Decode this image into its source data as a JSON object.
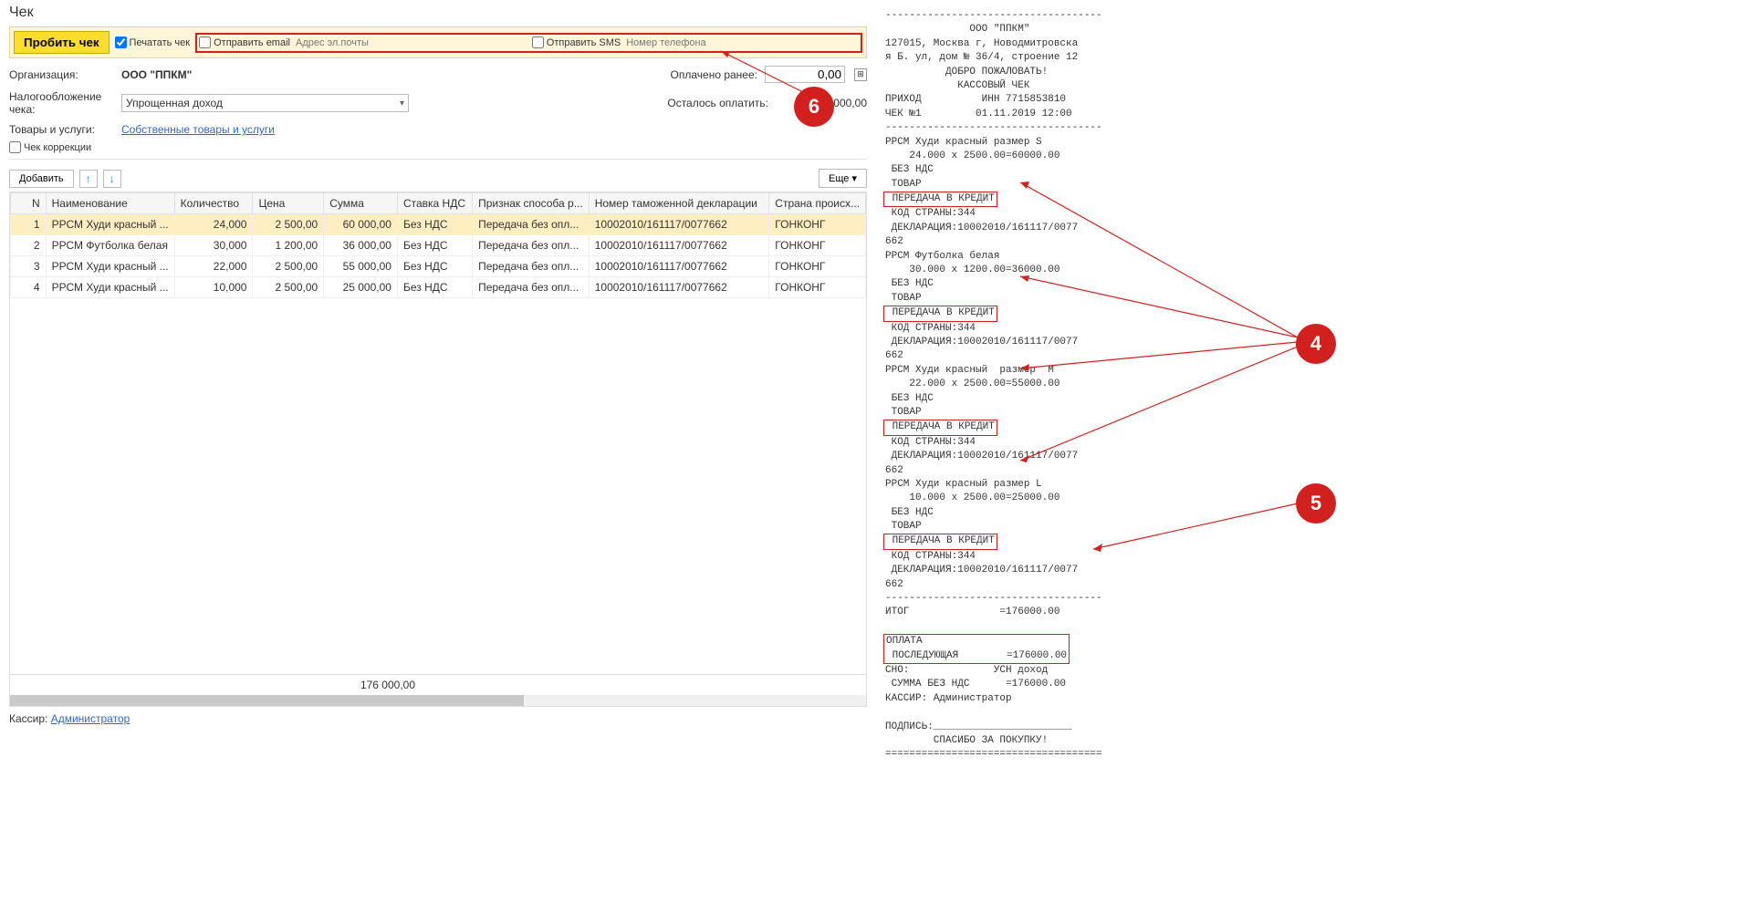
{
  "title": "Чек",
  "toolbar": {
    "probit": "Пробить чек",
    "print_check": "Печатать чек",
    "send_email": "Отправить email",
    "email_ph": "Адрес эл.почты",
    "send_sms": "Отправить SMS",
    "sms_ph": "Номер телефона"
  },
  "org_label": "Организация:",
  "org_value": "ООО \"ППКМ\"",
  "paid_label": "Оплачено ранее:",
  "paid_value": "0,00",
  "tax_label": "Налогообложение чека:",
  "tax_value": "Упрощенная доход",
  "left_to_pay_label": "Осталось оплатить:",
  "left_to_pay_value": "176 000,00",
  "goods_label": "Товары и услуги:",
  "goods_link": "Собственные товары и услуги",
  "chk_correction": "Чек коррекции",
  "btn_add": "Добавить",
  "btn_more": "Еще",
  "columns": {
    "n": "N",
    "name": "Наименование",
    "qty": "Количество",
    "price": "Цена",
    "sum": "Сумма",
    "vat": "Ставка НДС",
    "method": "Признак способа р...",
    "decl": "Номер таможенной декларации",
    "country": "Страна происх..."
  },
  "rows": [
    {
      "n": "1",
      "name": "РРСМ Худи красный ...",
      "qty": "24,000",
      "price": "2 500,00",
      "sum": "60 000,00",
      "vat": "Без НДС",
      "method": "Передача без опл...",
      "decl": "10002010/161117/0077662",
      "country": "ГОНКОНГ"
    },
    {
      "n": "2",
      "name": "РРСМ Футболка белая",
      "qty": "30,000",
      "price": "1 200,00",
      "sum": "36 000,00",
      "vat": "Без НДС",
      "method": "Передача без опл...",
      "decl": "10002010/161117/0077662",
      "country": "ГОНКОНГ"
    },
    {
      "n": "3",
      "name": "РРСМ Худи красный ...",
      "qty": "22,000",
      "price": "2 500,00",
      "sum": "55 000,00",
      "vat": "Без НДС",
      "method": "Передача без опл...",
      "decl": "10002010/161117/0077662",
      "country": "ГОНКОНГ"
    },
    {
      "n": "4",
      "name": "РРСМ Худи красный ...",
      "qty": "10,000",
      "price": "2 500,00",
      "sum": "25 000,00",
      "vat": "Без НДС",
      "method": "Передача без опл...",
      "decl": "10002010/161117/0077662",
      "country": "ГОНКОНГ"
    }
  ],
  "foot_total": "176 000,00",
  "cashier_label": "Кассир:",
  "cashier_link": "Администратор",
  "receipt": {
    "sep": "------------------------------------",
    "company": "              ООО \"ППКМ\"",
    "addr1": "127015, Москва г, Новодмитровска",
    "addr2": "я Б. ул, дом № 36/4, строение 12",
    "welcome": "          ДОБРО ПОЖАЛОВАТЬ!",
    "type": "            КАССОВЫЙ ЧЕК",
    "prihod": "ПРИХОД          ИНН 7715853810",
    "check": "ЧЕК №1         01.11.2019 12:00",
    "item1_name": "РРСМ Худи красный размер S",
    "item1_calc": "    24.000 x 2500.00=60000.00",
    "novatline": " БЕЗ НДС",
    "tovar": " ТОВАР",
    "credit": " ПЕРЕДАЧА В КРЕДИТ",
    "countrycode": " КОД СТРАНЫ:344",
    "decl1": " ДЕКЛАРАЦИЯ:10002010/161117/0077",
    "decl2": "662",
    "item2_name": "РРСМ Футболка белая",
    "item2_calc": "    30.000 x 1200.00=36000.00",
    "item3_name": "РРСМ Худи красный  размер  М",
    "item3_calc": "    22.000 x 2500.00=55000.00",
    "item4_name": "РРСМ Худи красный размер L",
    "item4_calc": "    10.000 x 2500.00=25000.00",
    "itog": "ИТОГ               =176000.00",
    "oplata": "ОПЛАТА",
    "posled": " ПОСЛЕДУЮЩАЯ        =176000.00",
    "sno": "СНО:              УСН доход",
    "sum_novatline": " СУММА БЕЗ НДС      =176000.00",
    "cashier": "КАССИР: Администратор",
    "sign": "ПОДПИСЬ:_______________________",
    "thanks": "        СПАСИБО ЗА ПОКУПКУ!"
  },
  "callouts": {
    "c4": "4",
    "c5": "5",
    "c6": "6"
  }
}
